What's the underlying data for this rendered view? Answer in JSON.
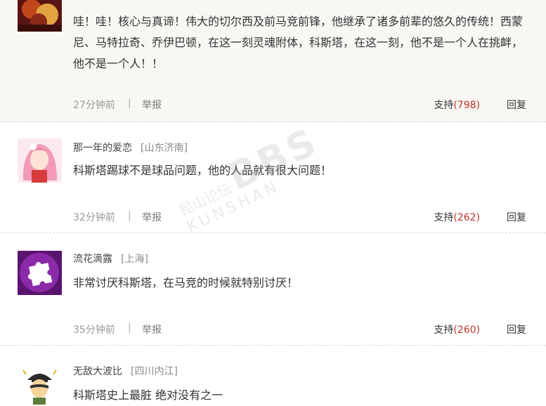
{
  "comments": [
    {
      "username": "",
      "location": "",
      "text": "哇！哇！核心与真谛！伟大的切尔西及前马竞前锋，他继承了诸多前辈的悠久的传统！西蒙尼、马特拉奇、乔伊巴顿，在这一刻灵魂附体，科斯塔，在这一刻，他不是一个人在挑衅，他不是一个人！！",
      "time": "27分钟前",
      "separator": "|",
      "report_label": "举报",
      "support_label": "支持",
      "support_count": "(798)",
      "reply_label": "回复"
    },
    {
      "username": "那一年的爱恋",
      "location": "[山东济南]",
      "text": "科斯塔踢球不是球品问题，他的人品就有很大问题！",
      "time": "32分钟前",
      "separator": "|",
      "report_label": "举报",
      "support_label": "支持",
      "support_count": "(262)",
      "reply_label": "回复"
    },
    {
      "username": "流花滴露",
      "location": "[上海]",
      "text": "非常讨厌科斯塔，在马竞的时候就特别讨厌！",
      "time": "35分钟前",
      "separator": "|",
      "report_label": "举报",
      "support_label": "支持",
      "support_count": "(260)",
      "reply_label": "回复"
    },
    {
      "username": "无敌大波比",
      "location": "[四川内江]",
      "text": "科斯塔史上最脏 绝对没有之一"
    }
  ],
  "watermark": {
    "top": "昆山论坛",
    "main": "BBS",
    "sub": "KUNSHAN"
  },
  "colors": {
    "highlight_bg": "#f8f7f4",
    "count": "#c0322b",
    "divider": "#d9d9d9"
  }
}
